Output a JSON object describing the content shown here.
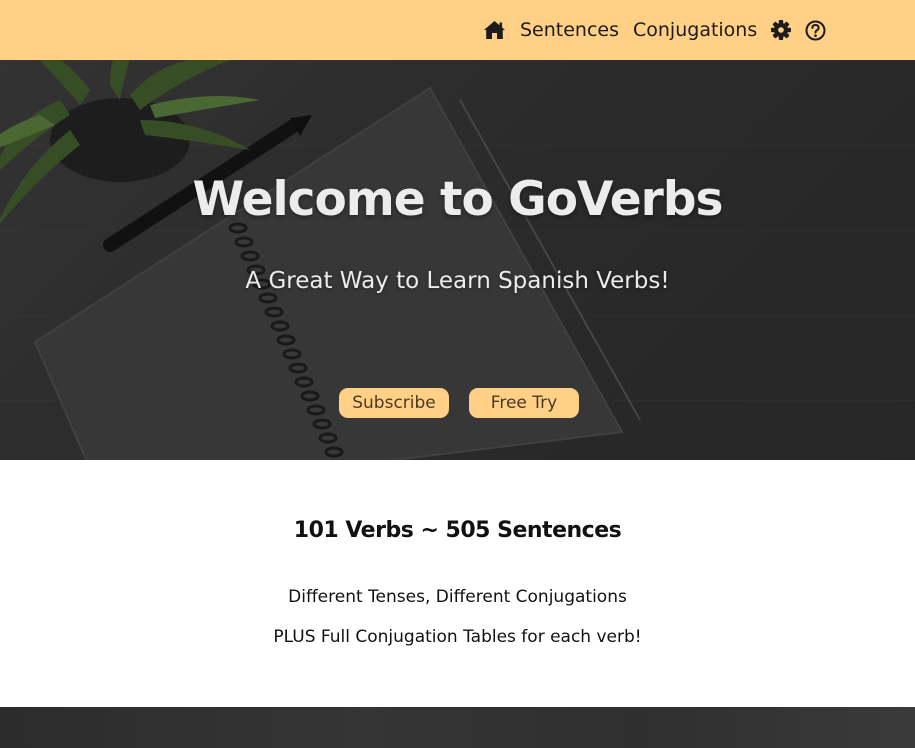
{
  "nav": {
    "links": [
      "Sentences",
      "Conjugations"
    ],
    "icons": [
      "home-icon",
      "gear-icon",
      "help-icon"
    ]
  },
  "hero": {
    "title": "Welcome to GoVerbs",
    "subtitle": "A Great Way to Learn Spanish Verbs!",
    "buttons": [
      "Subscribe",
      "Free Try"
    ]
  },
  "info": {
    "title": "101 Verbs ~ 505 Sentences",
    "lines": [
      "Different Tenses, Different Conjugations",
      "PLUS Full Conjugation Tables for each verb!"
    ]
  },
  "colors": {
    "accent": "#ffd085",
    "hero_bg": "#333333",
    "text_dark": "#111111",
    "text_light": "#ececec"
  }
}
